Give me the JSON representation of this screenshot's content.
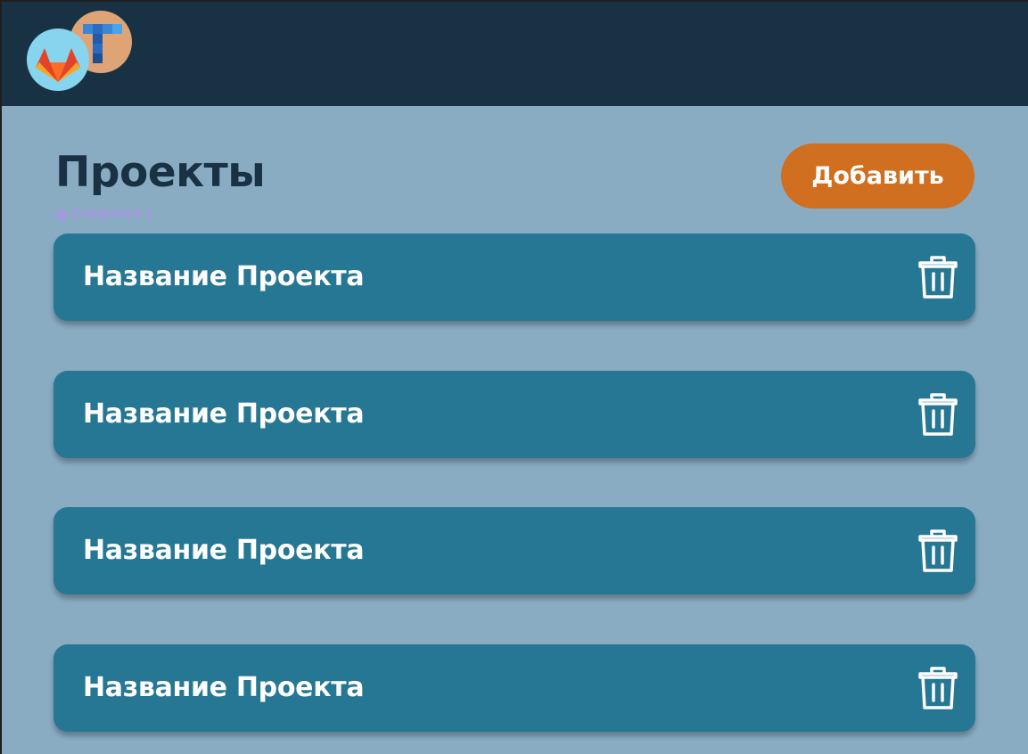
{
  "header": {
    "avatars": [
      {
        "icon": "gitlab-icon",
        "background": "#86d4ee"
      },
      {
        "icon": "t-logo-icon",
        "background": "#dfa476"
      }
    ]
  },
  "main": {
    "title": "Проекты",
    "add_button_label": "Добавить",
    "component_label": "Component 1",
    "projects": [
      {
        "name": "Название Проекта",
        "action_icon": "trash-icon"
      },
      {
        "name": "Название Проекта",
        "action_icon": "trash-icon"
      },
      {
        "name": "Название Проекта",
        "action_icon": "trash-icon"
      },
      {
        "name": "Название Проекта",
        "action_icon": "trash-icon"
      }
    ]
  },
  "colors": {
    "header_bg": "#183244",
    "page_bg": "#8aacc3",
    "card_bg": "#257794",
    "accent": "#d06f1f",
    "title_text": "#183244",
    "component_label": "#b48cf0"
  }
}
